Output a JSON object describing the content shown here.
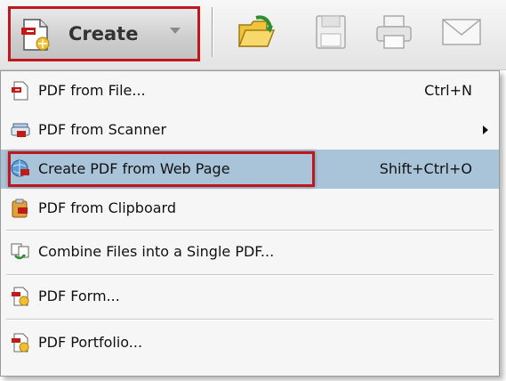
{
  "toolbar": {
    "create_label": "Create",
    "icons": [
      "open-folder-icon",
      "save-icon",
      "print-icon",
      "email-icon"
    ]
  },
  "menu": {
    "items": [
      {
        "label": "PDF from File...",
        "shortcut": "Ctrl+N",
        "icon": "pdf-from-file-icon"
      },
      {
        "label": "PDF from Scanner",
        "shortcut": "",
        "submenu": true,
        "icon": "scanner-icon"
      },
      {
        "label": "Create PDF from Web Page",
        "shortcut": "Shift+Ctrl+O",
        "selected": true,
        "icon": "web-page-icon"
      },
      {
        "label": "PDF from Clipboard",
        "shortcut": "",
        "icon": "clipboard-icon"
      },
      {
        "label": "Combine Files into a Single PDF...",
        "shortcut": "",
        "icon": "combine-files-icon"
      },
      {
        "label": "PDF Form...",
        "shortcut": "",
        "icon": "pdf-form-icon"
      },
      {
        "label": "PDF Portfolio...",
        "shortcut": "",
        "icon": "pdf-portfolio-icon"
      }
    ]
  },
  "colors": {
    "highlight": "#c0161d",
    "selection": "#a9c4d9"
  }
}
